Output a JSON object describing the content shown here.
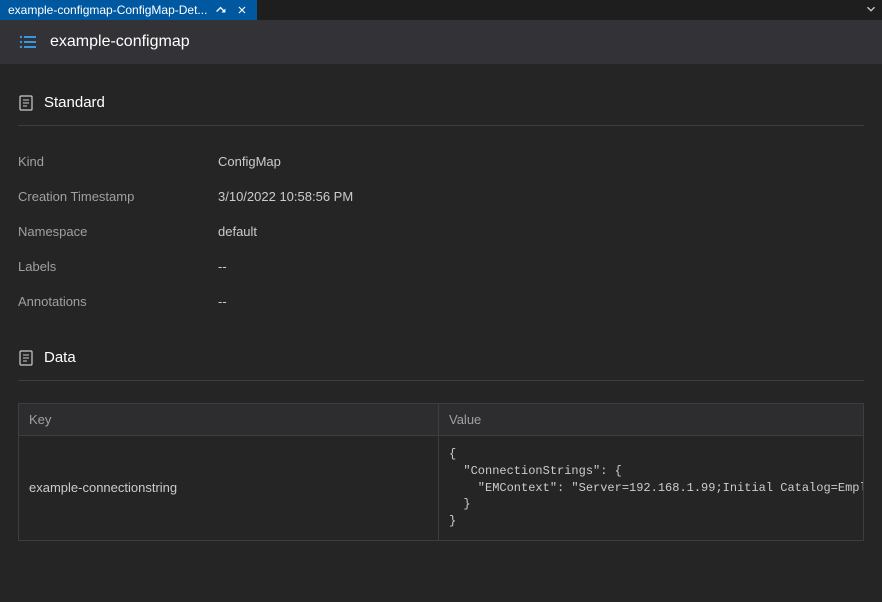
{
  "tab": {
    "label": "example-configmap-ConfigMap-Det..."
  },
  "header": {
    "title": "example-configmap"
  },
  "sections": {
    "standard": {
      "title": "Standard",
      "fields": {
        "kind": {
          "label": "Kind",
          "value": "ConfigMap"
        },
        "creationTimestamp": {
          "label": "Creation Timestamp",
          "value": "3/10/2022 10:58:56 PM"
        },
        "namespace": {
          "label": "Namespace",
          "value": "default"
        },
        "labels": {
          "label": "Labels",
          "value": "--"
        },
        "annotations": {
          "label": "Annotations",
          "value": "--"
        }
      }
    },
    "data": {
      "title": "Data",
      "table": {
        "headers": {
          "key": "Key",
          "value": "Value"
        },
        "rows": [
          {
            "key": "example-connectionstring",
            "value": "{\n  \"ConnectionStrings\": {\n    \"EMContext\": \"Server=192.168.1.99;Initial Catalog=EmployeeManager;Multip\n  }\n}"
          }
        ]
      }
    }
  }
}
